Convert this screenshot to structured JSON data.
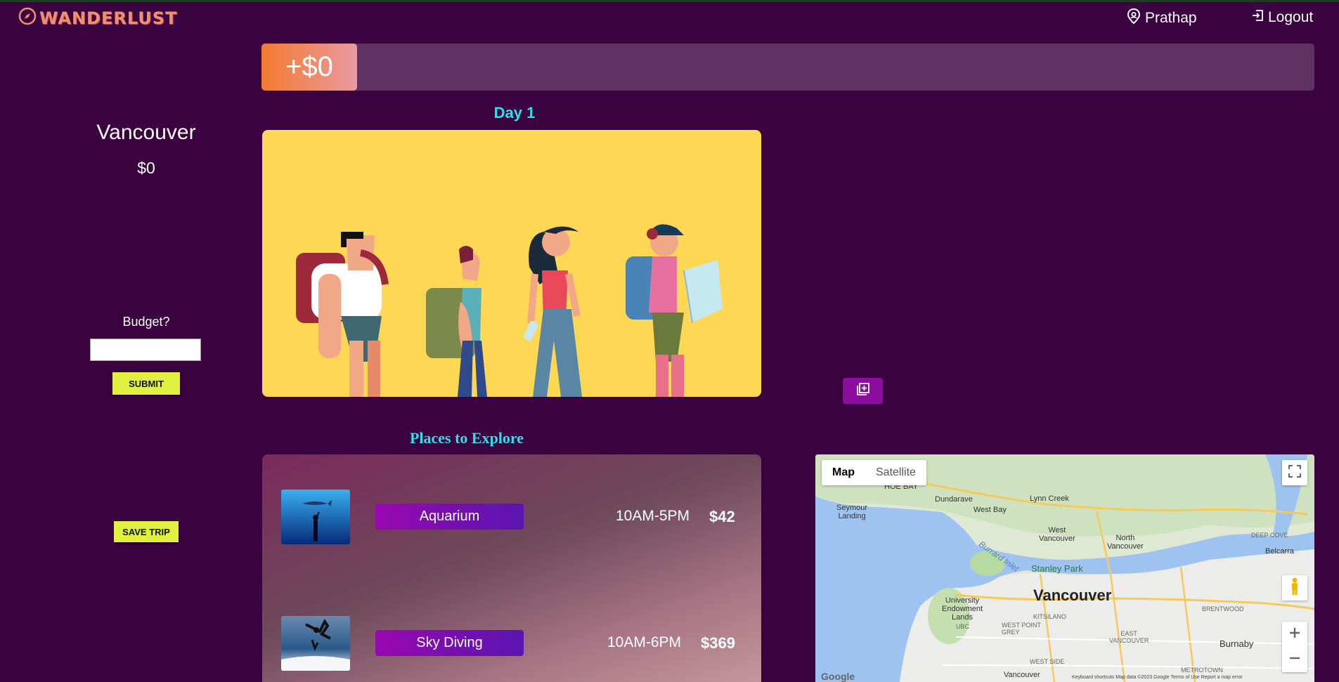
{
  "nav": {
    "logo_text": "WANDERLUST",
    "user_name": "Prathap",
    "logout_label": "Logout"
  },
  "sidebar": {
    "city": "Vancouver",
    "total": "$0",
    "budget_label": "Budget?",
    "budget_value": "",
    "submit_label": "SUBMIT",
    "save_label": "SAVE TRIP"
  },
  "budget_bar": {
    "amount_label": "+$0"
  },
  "day": {
    "title": "Day 1"
  },
  "places": {
    "title": "Places to Explore",
    "items": [
      {
        "name": "Aquarium",
        "hours": "10AM-5PM",
        "price": "$42"
      },
      {
        "name": "Sky Diving",
        "hours": "10AM-6PM",
        "price": "$369"
      }
    ]
  },
  "map": {
    "type_options": [
      "Map",
      "Satellite"
    ],
    "selected_type": "Map",
    "main_city": "Vancouver",
    "labels": {
      "seymour": "Seymour\nLanding",
      "dundarave": "Dundarave",
      "west_bay": "West Bay",
      "west_vancouver": "West\nVancouver",
      "north_vancouver": "North\nVancouver",
      "lynn_creek": "Lynn Creek",
      "deep_cove": "DEEP COVE",
      "belcarra": "Belcarra",
      "stanley_park": "Stanley Park",
      "burrard_inlet": "Burrard Inlet",
      "ube": "University\nEndowment\nLands",
      "kitsilano": "KITSILANO",
      "west_point_grey": "WEST POINT\nGREY",
      "ubc": "UBC",
      "brentwood": "BRENTWOOD",
      "east_vancouver": "EAST\nVANCOUVER",
      "burnaby": "Burnaby",
      "west_side": "WEST SIDE",
      "metrotown": "METROTOWN",
      "vancouver_south": "Vancouver",
      "hoe_bay": "HOE BAY"
    },
    "footer": "Keyboard shortcuts   Map data ©2023 Google   Terms of Use   Report a map error",
    "google": "Google"
  },
  "colors": {
    "background": "#3a0340",
    "accent_cyan": "#31dfe8",
    "button_yellow": "#dff03f",
    "place_button": "#9808b0",
    "progress_track": "#5e3363",
    "hero_bg": "#fed755"
  },
  "icons": {
    "logo": "compass-icon",
    "user": "location-pin-icon",
    "logout": "logout-icon",
    "add": "add-to-library-icon",
    "fullscreen": "fullscreen-icon",
    "pegman": "street-view-pegman-icon",
    "zoom_in": "plus-icon",
    "zoom_out": "minus-icon"
  }
}
